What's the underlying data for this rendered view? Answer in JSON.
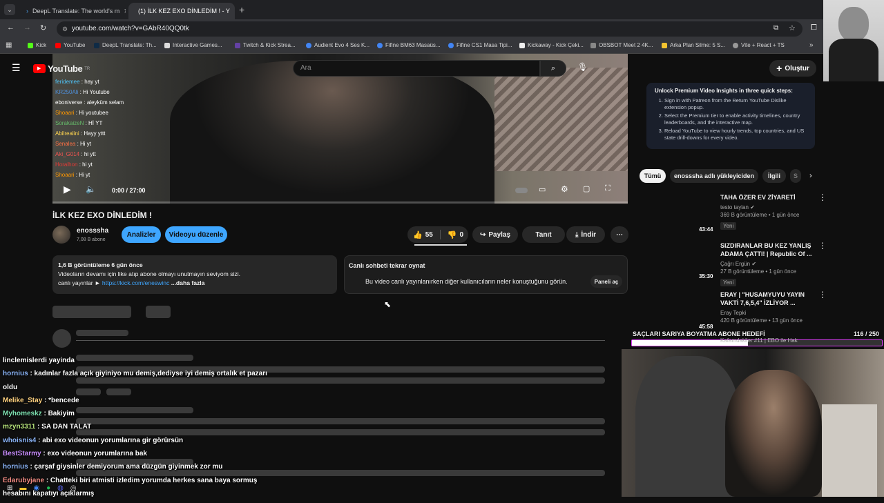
{
  "browser": {
    "tabs": [
      {
        "title": "DeepL Translate: The world's m",
        "active": false
      },
      {
        "title": "(1) İLK KEZ EXO DİNLEDİM ! - Y",
        "active": true
      }
    ],
    "url": "youtube.com/watch?v=GAbR40QQ0tk",
    "bookmarks": [
      "Kick",
      "YouTube",
      "DeepL Translate: Th...",
      "Interactive Games...",
      "Twitch & Kick Strea...",
      "Audient Evo 4 Ses K...",
      "Fifine BM63 Masaüs...",
      "Fifine CS1 Masa Tipi...",
      "Kickaway - Kick Çeki...",
      "OBSBOT Meet 2 4K...",
      "Arka Plan Silme: 5 S...",
      "Vite + React + TS"
    ],
    "accent_red": "#ff0000",
    "accent_blue": "#3ea6ff"
  },
  "youtube": {
    "logo": "YouTube",
    "logo_sup": "TR",
    "search_placeholder": "Ara",
    "create_label": "Oluştur",
    "video_chat": [
      {
        "user": "feridemee",
        "msg": "hay yt",
        "color": "#4fc3f7"
      },
      {
        "user": "KR250Ali",
        "msg": "Hi Youtube",
        "color": "#4f8fd9"
      },
      {
        "user": "eboniverse",
        "msg": "aleyküm selam",
        "color": "#ffffff"
      },
      {
        "user": "Shoaari",
        "msg": "Hi youtubee",
        "color": "#ff9800"
      },
      {
        "user": "SorakaizeN",
        "msg": "Hİ YT",
        "color": "#66bb6a"
      },
      {
        "user": "Abilrealini",
        "msg": "Hayy yttt",
        "color": "#ffd54f"
      },
      {
        "user": "Senalea",
        "msg": "Hi yt",
        "color": "#ff7043"
      },
      {
        "user": "Aki_G014",
        "msg": "hi ytt",
        "color": "#ef5350"
      },
      {
        "user": "Horalhon",
        "msg": "hi yt",
        "color": "#e53935"
      },
      {
        "user": "Shoaari",
        "msg": "Hi yt",
        "color": "#ff9800"
      }
    ],
    "player_time": "0:00 / 27:00",
    "video_title": "İLK KEZ EXO DİNLEDİM !",
    "channel_name": "enosssha",
    "subscribers": "7,08 B abone",
    "analytics_btn": "Analizler",
    "edit_btn": "Videoyu düzenle",
    "likes": "55",
    "dislikes": "0",
    "share": "Paylaş",
    "promote": "Tanıt",
    "download": "İndir",
    "desc_stats": "1,6 B görüntüleme  6 gün önce",
    "desc_line1": "Videoların devamı için like atıp abone olmayı unutmayın seviyom sizi.",
    "desc_line2_prefix": "canlı yayınlar ►",
    "desc_link": "https://kick.com/eneswinc",
    "desc_more": "...daha fazla",
    "replay_title": "Canlı sohbeti tekrar oynat",
    "replay_text": "Bu video canlı yayınlanırken diğer kullanıcıların neler konuştuğunu görün.",
    "replay_btn": "Paneli aç"
  },
  "sidebar": {
    "insights_title": "Unlock Premium Video Insights in three quick steps:",
    "insights_steps": [
      "Sign in with Patreon from the Return YouTube Dislike extension popup.",
      "Select the Premium tier to enable activity timelines, country leaderboards, and the interactive map.",
      "Reload YouTube to view hourly trends, top countries, and US state drill-downs for every video."
    ],
    "chips": [
      "Tümü",
      "enosssha adlı yükleyiciden",
      "İlgili",
      "S"
    ],
    "recs": [
      {
        "title1": "TAHA ÖZER EV ZİYARETİ",
        "title2": "",
        "channel": "testo taylan",
        "meta": "369 B görüntüleme • 1 gün önce",
        "badge": "Yeni",
        "duration": "43:44"
      },
      {
        "title1": "SIZDIRANLAR BU KEZ YANLIŞ",
        "title2": "ADAMA ÇATTI! | Republic Of ...",
        "channel": "Çağrı Ergün",
        "meta": "27 B görüntüleme • 1 gün önce",
        "badge": "Yeni",
        "duration": "35:30"
      },
      {
        "title1": "ERAY | \"HUSAMYUYU YAYIN",
        "title2": "VAKTİ 7,6,5,4\" İZLİYOR ...",
        "channel": "Eray Tepki",
        "meta": "420 B görüntüleme • 13 gün önce",
        "badge": "",
        "duration": "45:58"
      }
    ]
  },
  "stream_overlay": {
    "goal_label": "SAÇLARI SARIYA BOYATMA ABONE HEDEFİ",
    "goal_count": "116 / 250",
    "goal_progress": 0.464,
    "goal_under": "Kafamdakiler #11 | EBO ile Hak",
    "chat": [
      {
        "user": "",
        "msg": "linclemislerdi yayinda",
        "color": "#ffffff"
      },
      {
        "user": "hornius",
        "msg": ": kadınlar fazla açık giyiniyo mu demiş,dediyse iyi demiş ortalık et pazarı",
        "color": "#8ab4f8"
      },
      {
        "user": "",
        "msg": "oldu",
        "color": "#ffffff"
      },
      {
        "user": "Melike_Stay",
        "msg": ": *bencede",
        "color": "#ffd27f"
      },
      {
        "user": "Myhomeskz",
        "msg": ": Bakiyim",
        "color": "#7de0b0"
      },
      {
        "user": "mzyn3311",
        "msg": ": SA DAN TALAT",
        "color": "#b6e37a"
      },
      {
        "user": "whoisnis4",
        "msg": ": abi exo videonun yorumlarına gir görürsün",
        "color": "#8ab4f8"
      },
      {
        "user": "BestStarmy",
        "msg": ": exo videonun yorumlarına bak",
        "color": "#c58af9"
      },
      {
        "user": "hornius",
        "msg": ": çarşaf giysinler demiyorum ama düzgün giyinmek zor mu",
        "color": "#8ab4f8"
      },
      {
        "user": "Edarubyjane",
        "msg": ": Chatteki biri atmisti izledim yorumda herkes sana baya sormuş",
        "color": "#f28b82"
      },
      {
        "user": "",
        "msg": "hesabını kapatıyı açıklarmış",
        "color": "#ffffff"
      }
    ]
  }
}
